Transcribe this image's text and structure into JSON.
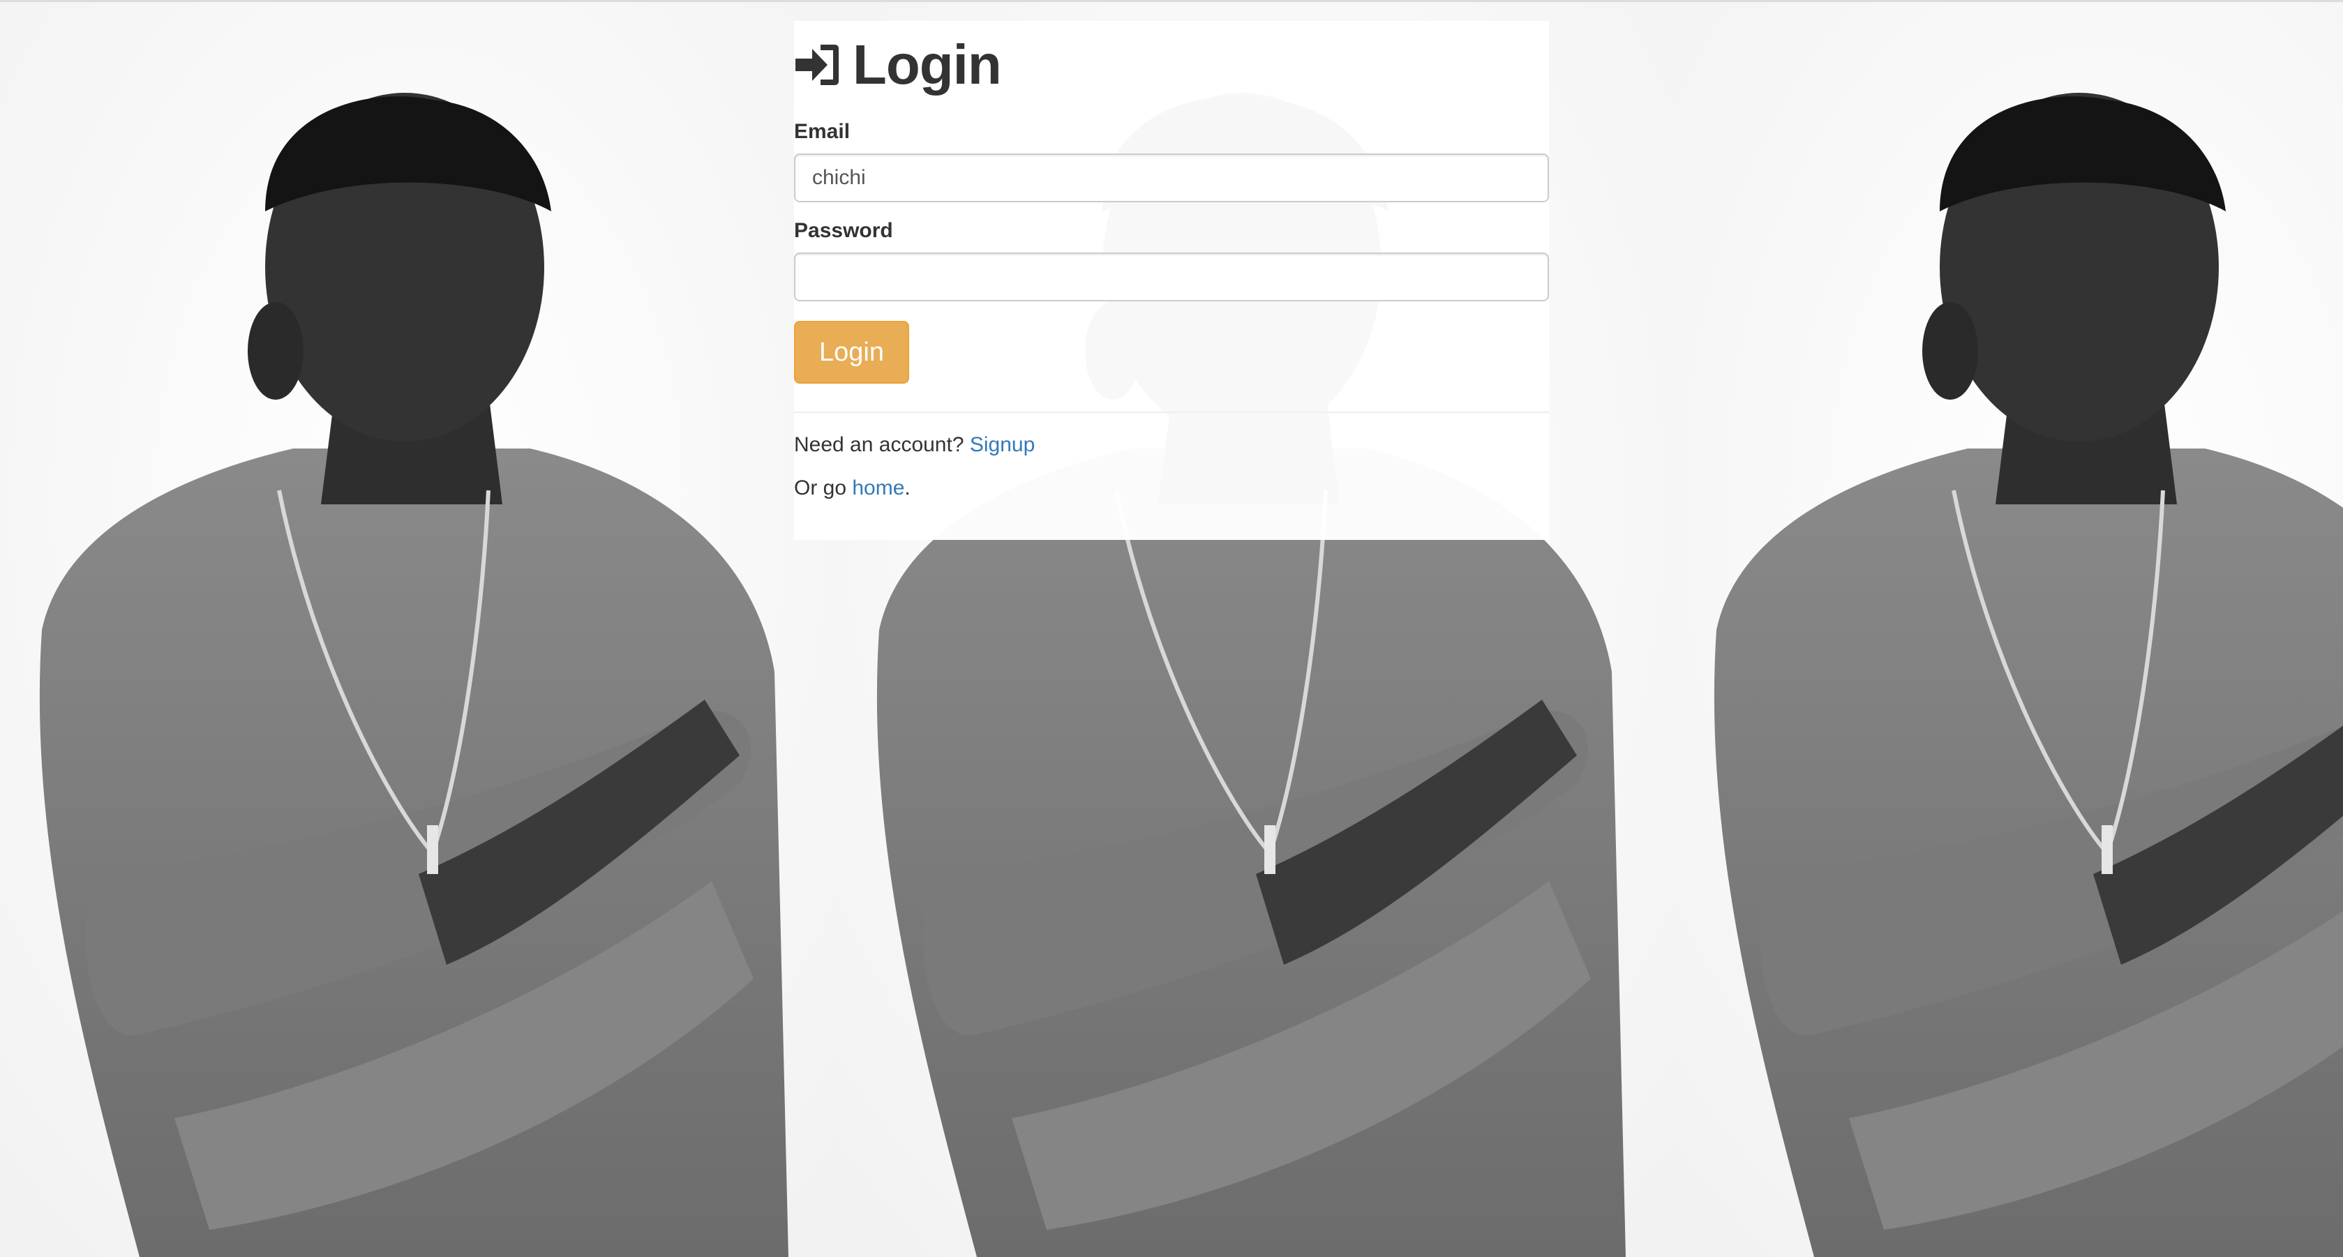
{
  "page": {
    "title": "Login",
    "icon": "sign-in-icon"
  },
  "form": {
    "email_label": "Email",
    "email_value": "chichi",
    "password_label": "Password",
    "password_value": "",
    "submit_label": "Login"
  },
  "footer": {
    "signup_prefix": "Need an account?",
    "signup_link": "Signup",
    "home_prefix": "Or go",
    "home_link": "home",
    "home_suffix": "."
  },
  "background": {
    "description_icon": "portrait-photo",
    "tile_count": 3
  },
  "colors": {
    "button_bg": "#e8ad55",
    "button_border": "#eea236",
    "link": "#337ab7",
    "text": "#333333"
  }
}
